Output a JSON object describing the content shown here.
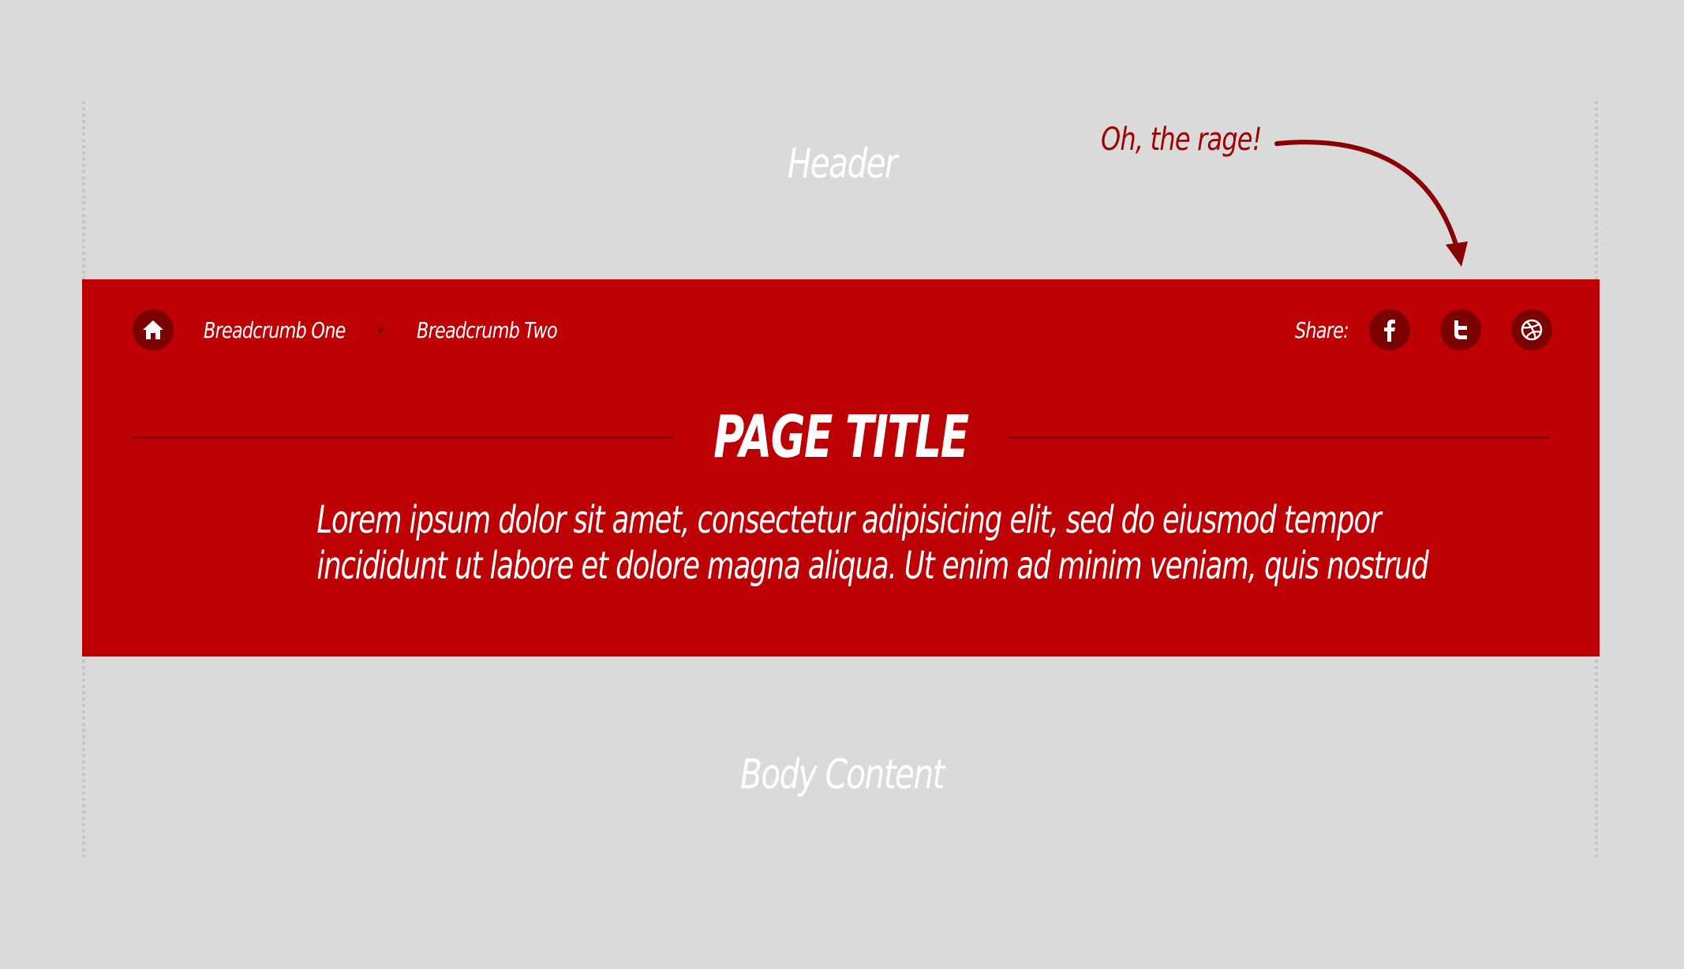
{
  "labels": {
    "header": "Header",
    "body": "Body Content",
    "annotation": "Oh, the rage!"
  },
  "breadcrumb": {
    "home_icon": "home-icon",
    "items": [
      {
        "label": "Breadcrumb One"
      },
      {
        "label": "Breadcrumb Two"
      }
    ]
  },
  "share": {
    "label": "Share:",
    "networks": [
      {
        "name": "facebook",
        "icon": "facebook-icon"
      },
      {
        "name": "twitter",
        "icon": "twitter-icon"
      },
      {
        "name": "dribbble",
        "icon": "dribbble-icon"
      }
    ]
  },
  "hero": {
    "title": "PAGE TITLE",
    "description_lines": [
      "Lorem ipsum dolor sit amet, consectetur adipisicing elit, sed do eiusmod tempor",
      "incididunt ut labore et dolore magna aliqua. Ut enim ad minim veniam, quis nostrud"
    ]
  },
  "colors": {
    "background": "#dadada",
    "band": "#bd0003",
    "icon_circle": "#7b0000",
    "annotation": "#a30000"
  }
}
